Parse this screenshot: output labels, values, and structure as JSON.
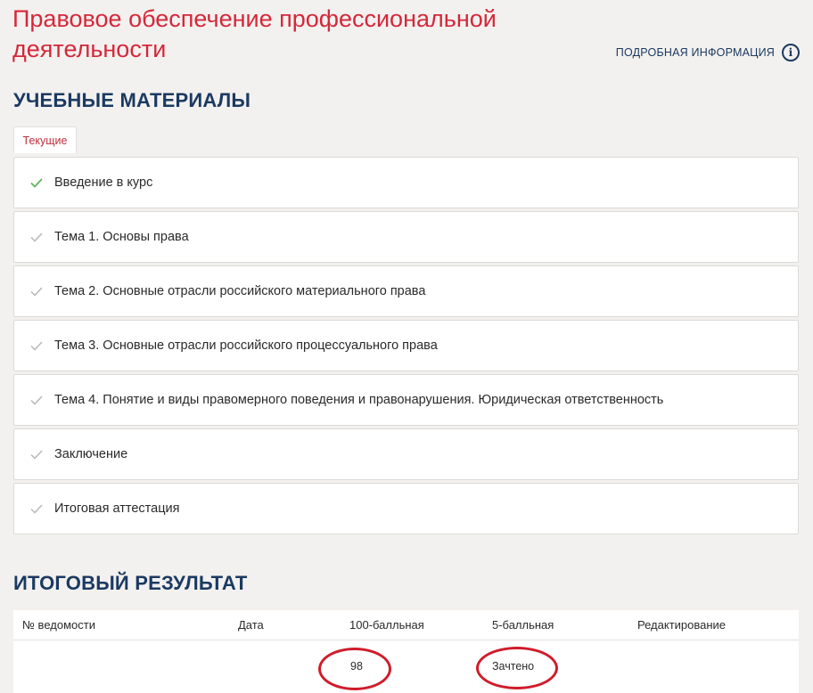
{
  "course": {
    "title": "Правовое обеспечение профессиональной деятельности",
    "more_info_label": "ПОДРОБНАЯ ИНФОРМАЦИЯ",
    "info_icon": "info-icon"
  },
  "materials": {
    "section_title": "УЧЕБНЫЕ МАТЕРИАЛЫ",
    "tab_label": "Текущие",
    "items": [
      {
        "label": "Введение в курс",
        "status": "completed"
      },
      {
        "label": "Тема 1. Основы права",
        "status": "pending"
      },
      {
        "label": "Тема 2.  Основные отрасли российского материального права",
        "status": "pending"
      },
      {
        "label": "Тема 3. Основные отрасли российского процессуального права",
        "status": "pending"
      },
      {
        "label": "Тема 4. Понятие и виды правомерного поведения и правонарушения. Юридическая ответственность",
        "status": "pending"
      },
      {
        "label": "Заключение",
        "status": "pending"
      },
      {
        "label": "Итоговая аттестация",
        "status": "pending"
      }
    ]
  },
  "results": {
    "section_title": "ИТОГОВЫЙ РЕЗУЛЬТАТ",
    "columns": [
      "№ ведомости",
      "Дата",
      "100-балльная",
      "5-балльная",
      "Редактирование"
    ],
    "rows": [
      {
        "statement_no": "",
        "date": "",
        "score_100": "98",
        "score_5": "Зачтено",
        "edit": ""
      }
    ]
  },
  "colors": {
    "title_red": "#d4283a",
    "navy": "#1b3a62",
    "check_done": "#5cb85c",
    "check_pending": "#b8b8b8",
    "highlight_ellipse": "#d01c2a"
  }
}
